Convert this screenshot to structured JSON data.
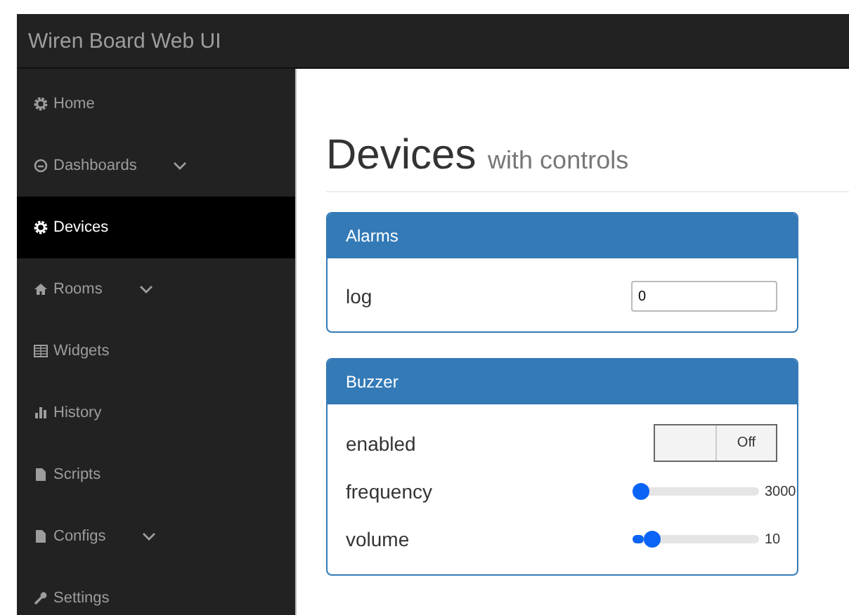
{
  "header": {
    "title": "Wiren Board Web UI"
  },
  "sidebar": {
    "items": [
      {
        "label": "Home",
        "selected": false,
        "expandable": false
      },
      {
        "label": "Dashboards",
        "selected": false,
        "expandable": true
      },
      {
        "label": "Devices",
        "selected": true,
        "expandable": false
      },
      {
        "label": "Rooms",
        "selected": false,
        "expandable": true
      },
      {
        "label": "Widgets",
        "selected": false,
        "expandable": false
      },
      {
        "label": "History",
        "selected": false,
        "expandable": false
      },
      {
        "label": "Scripts",
        "selected": false,
        "expandable": false
      },
      {
        "label": "Configs",
        "selected": false,
        "expandable": true
      },
      {
        "label": "Settings",
        "selected": false,
        "expandable": false
      }
    ]
  },
  "page": {
    "title": "Devices",
    "subtitle": "with controls"
  },
  "devices": [
    {
      "name": "Alarms",
      "controls": [
        {
          "kind": "text",
          "label": "log",
          "value": "0"
        }
      ]
    },
    {
      "name": "Buzzer",
      "controls": [
        {
          "kind": "switch",
          "label": "enabled",
          "on": false,
          "state": "Off"
        },
        {
          "kind": "range",
          "label": "frequency",
          "level": 0.0,
          "reading": "3000"
        },
        {
          "kind": "range",
          "label": "volume",
          "level": 0.1,
          "reading": "10"
        }
      ]
    }
  ]
}
